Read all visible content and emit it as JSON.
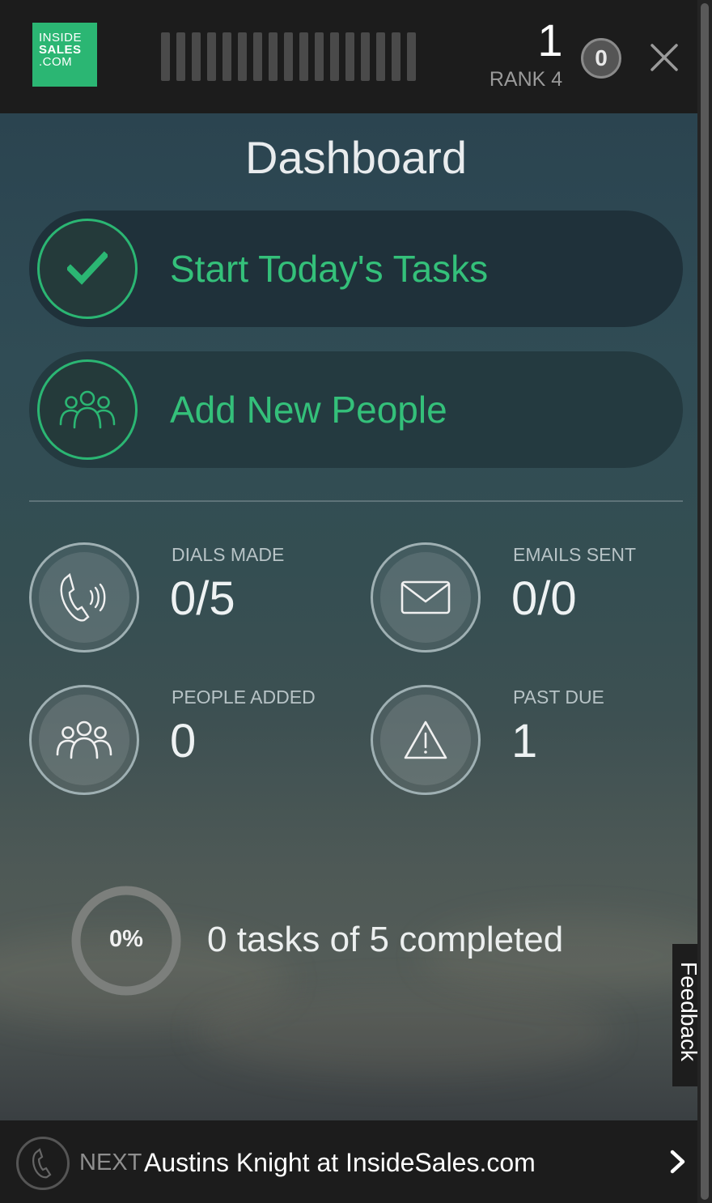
{
  "header": {
    "logo": [
      "INSIDE",
      "SALES",
      ".COM"
    ],
    "rank_number": "1",
    "rank_label": "RANK 4",
    "notification_count": "0"
  },
  "dashboard": {
    "title": "Dashboard",
    "actions": [
      {
        "label": "Start Today's Tasks",
        "icon": "checkmark-icon"
      },
      {
        "label": "Add New People",
        "icon": "people-icon"
      }
    ],
    "stats": [
      {
        "label": "DIALS MADE",
        "value": "0/5",
        "icon": "phone-ringing-icon"
      },
      {
        "label": "EMAILS SENT",
        "value": "0/0",
        "icon": "envelope-icon"
      },
      {
        "label": "PEOPLE ADDED",
        "value": "0",
        "icon": "people-icon"
      },
      {
        "label": "PAST DUE",
        "value": "1",
        "icon": "warning-icon"
      }
    ],
    "progress": {
      "percent_label": "0%",
      "percent": 0,
      "summary": "0 tasks of 5 completed"
    }
  },
  "feedback_tab": {
    "label": "Feedback"
  },
  "next_call": {
    "prefix": "NEXT",
    "contact": "Austins Knight at InsideSales.com"
  },
  "colors": {
    "accent_green": "#2bb673",
    "action_text_green": "#34c07a",
    "bar_background": "#1c1c1c"
  }
}
